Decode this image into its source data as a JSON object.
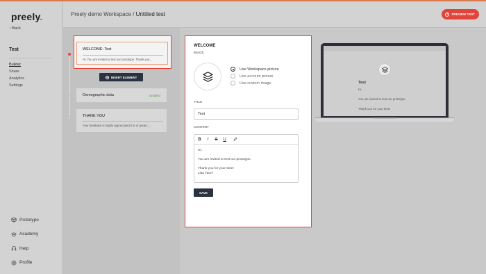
{
  "app": {
    "logo": "preely",
    "logo_dot": "."
  },
  "colors": {
    "accent": "#e2443a",
    "dark_button": "#2a3140",
    "enabled": "#5aa04a"
  },
  "sidebar": {
    "back_label": "‹ Back",
    "project_name": "Test",
    "nav": [
      {
        "label": "Builder",
        "active": true
      },
      {
        "label": "Share",
        "active": false
      },
      {
        "label": "Analytics",
        "active": false
      },
      {
        "label": "Settings",
        "active": false
      }
    ],
    "bottom_nav": [
      {
        "label": "Prototype",
        "icon": "cube-icon"
      },
      {
        "label": "Academy",
        "icon": "academy-icon"
      },
      {
        "label": "Help",
        "icon": "headset-icon"
      },
      {
        "label": "Profile",
        "icon": "profile-icon"
      }
    ]
  },
  "header": {
    "workspace": "Preely demo Workspace",
    "separator": " / ",
    "test_name": "Untitled test",
    "preview_button": "PREVIEW TEST"
  },
  "elements": {
    "welcome": {
      "title": "WELCOME:  Test",
      "subtitle": "Hi, You are invited to test our prototype. Thank you..."
    },
    "insert_button": "INSERT ELEMENT",
    "demographic": {
      "title": "Demographic data",
      "status": "Enabled"
    },
    "thankyou": {
      "title": "THANK YOU",
      "subtitle": "Your feedback is highly appreciated.It is of great i..."
    }
  },
  "editor": {
    "title": "WELCOME",
    "image_label": "IMAGE",
    "image_options": [
      {
        "label": "Use Workspace picture",
        "selected": true
      },
      {
        "label": "Use account picture",
        "selected": false
      },
      {
        "label": "Use custom image",
        "selected": false
      }
    ],
    "title_label": "TITLE",
    "title_value": "Test",
    "content_label": "CONTENT",
    "toolbar": {
      "bold": "B",
      "italic": "I",
      "strike": "S",
      "underline": "U",
      "link_icon": "link-icon"
    },
    "content_lines": [
      "Hi,",
      "",
      "You are invited to test our prototype.",
      "",
      "Thank you for your time!",
      "Lisa TEST"
    ],
    "save_button": "SAVE"
  },
  "preview": {
    "title": "Test",
    "lines": [
      "Hi,",
      "",
      "You are invited to test our prototype.",
      "",
      "Thank you for your time!"
    ]
  }
}
